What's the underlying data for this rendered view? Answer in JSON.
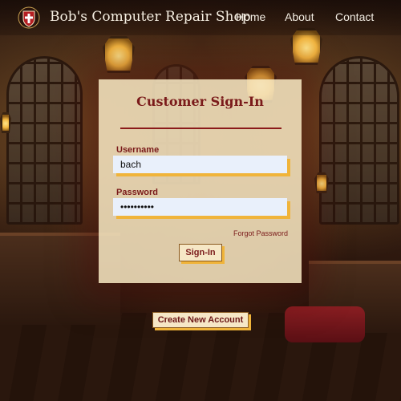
{
  "header": {
    "brand": "Bob's Computer Repair Shop",
    "nav": [
      {
        "label": "Home"
      },
      {
        "label": "About"
      },
      {
        "label": "Contact"
      }
    ]
  },
  "signin": {
    "title": "Customer Sign-In",
    "username_label": "Username",
    "username_value": "bach",
    "password_label": "Password",
    "password_value": "••••••••••",
    "forgot_link": "Forgot Password",
    "submit_label": "Sign-In"
  },
  "create_account_label": "Create New Account",
  "colors": {
    "accent": "#7a1a1a",
    "button_shadow": "#f0b43a",
    "card_bg": "#f4e3be",
    "input_bg": "#e9f0fb"
  },
  "icons": {
    "logo": "shield-cross-icon"
  }
}
